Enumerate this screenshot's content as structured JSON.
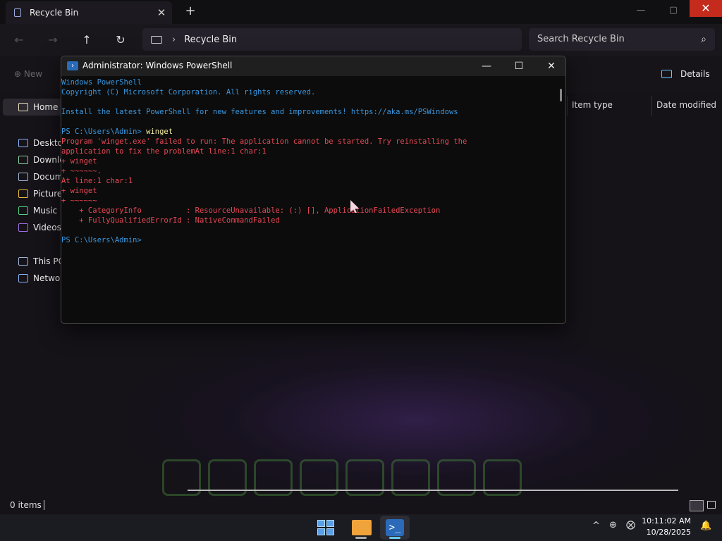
{
  "explorer": {
    "tab_title": "Recycle Bin",
    "tab_close": "✕",
    "new_tab": "+",
    "window_controls": {
      "minimize": "—",
      "maximize": "▢",
      "close": "✕"
    },
    "nav": {
      "back": "←",
      "forward": "→",
      "up": "↑",
      "refresh": "↻"
    },
    "address_separator": "›",
    "address": "Recycle Bin",
    "search_placeholder": "Search Recycle Bin",
    "toolbar": {
      "new_label": "New",
      "details_label": "Details"
    },
    "sidebar": [
      {
        "label": "Home",
        "icon": "home-icon",
        "color": "#e8e0c0"
      },
      {
        "label": "Desktop",
        "icon": "desktop-icon",
        "color": "#8ab4f8"
      },
      {
        "label": "Downloads",
        "icon": "download-icon",
        "color": "#8ad0a0"
      },
      {
        "label": "Documents",
        "icon": "document-icon",
        "color": "#9fb8d8"
      },
      {
        "label": "Pictures",
        "icon": "picture-icon",
        "color": "#e8c040"
      },
      {
        "label": "Music",
        "icon": "music-icon",
        "color": "#50d080"
      },
      {
        "label": "Videos",
        "icon": "video-icon",
        "color": "#a070e0"
      },
      {
        "label": "This PC",
        "icon": "pc-icon",
        "color": "#9fb8d8"
      },
      {
        "label": "Network",
        "icon": "network-icon",
        "color": "#8ab4f8"
      }
    ],
    "columns": {
      "item_type": "Item type",
      "date_modified": "Date modified"
    },
    "status": {
      "count": "0 items"
    }
  },
  "powershell": {
    "title": "Administrator: Windows PowerShell",
    "controls": {
      "minimize": "—",
      "maximize": "☐",
      "close": "✕"
    },
    "lines": [
      {
        "text": "Windows PowerShell",
        "color": "blue"
      },
      {
        "text": "Copyright (C) Microsoft Corporation. All rights reserved.",
        "color": "blue"
      },
      {
        "text": "",
        "color": "white"
      },
      {
        "text": "Install the latest PowerShell for new features and improvements! https://aka.ms/PSWindows",
        "color": "blue"
      },
      {
        "text": "",
        "color": "white"
      },
      {
        "text": "PS C:\\Users\\Admin> ",
        "color": "blue",
        "cmd": "winget"
      },
      {
        "text": "Program 'winget.exe' failed to run: The application cannot be started. Try reinstalling the",
        "color": "red"
      },
      {
        "text": "application to fix the problemAt line:1 char:1",
        "color": "red"
      },
      {
        "text": "+ winget",
        "color": "red"
      },
      {
        "text": "+ ~~~~~~.",
        "color": "red"
      },
      {
        "text": "At line:1 char:1",
        "color": "red"
      },
      {
        "text": "+ winget",
        "color": "red"
      },
      {
        "text": "+ ~~~~~~",
        "color": "red"
      },
      {
        "text": "    + CategoryInfo          : ResourceUnavailable: (:) [], ApplicationFailedException",
        "color": "red"
      },
      {
        "text": "    + FullyQualifiedErrorId : NativeCommandFailed",
        "color": "red"
      },
      {
        "text": "",
        "color": "white"
      },
      {
        "text": "PS C:\\Users\\Admin>",
        "color": "blue"
      }
    ]
  },
  "taskbar": {
    "apps": [
      {
        "name": "start-button",
        "icon": "windows-start-icon"
      },
      {
        "name": "file-explorer",
        "icon": "folder-icon"
      },
      {
        "name": "powershell",
        "icon": "powershell-icon",
        "active": true
      }
    ],
    "ps_glyph": ">_",
    "tray": {
      "chevron": "^",
      "network": "⊕",
      "sound": "⨂",
      "bell": "🔔"
    },
    "time": "10:11:02 AM",
    "date": "10/28/2025"
  }
}
